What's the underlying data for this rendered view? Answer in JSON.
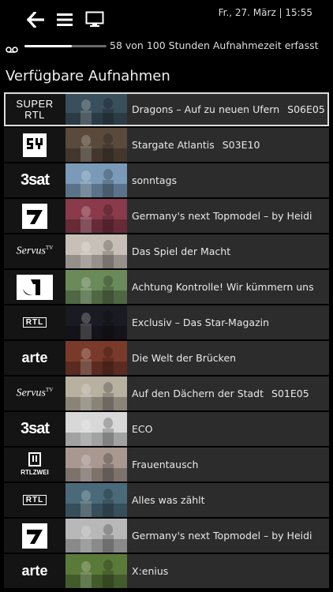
{
  "header": {
    "back_icon": "arrow-left-icon",
    "menu_icon": "hamburger-menu-icon",
    "tv_icon": "tv-monitor-icon",
    "datetime": "Fr., 27. März | 15:55"
  },
  "quota": {
    "icon": "voicemail-tape-icon",
    "used_fraction": 0.58,
    "label": "58 von 100 Stunden Aufnahmezeit erfasst"
  },
  "section_title": "Verfügbare Aufnahmen",
  "recordings": [
    {
      "channel": "SUPER RTL",
      "channel_line1": "SUPER",
      "channel_line2": "RTL",
      "logo": "superrtl",
      "title": "Dragons – Auf zu neuen Ufern",
      "episode": "S06E05",
      "selected": true,
      "thumb_color": "#3a4f5c"
    },
    {
      "channel": "SYFY",
      "logo": "syfy",
      "title": "Stargate Atlantis",
      "episode": "S03E10",
      "selected": false,
      "thumb_color": "#5a4a3c"
    },
    {
      "channel": "3sat",
      "logo": "3sat",
      "title": "sonntags",
      "episode": "",
      "selected": false,
      "thumb_color": "#7a9ab8"
    },
    {
      "channel": "ProSieben",
      "logo": "pro7",
      "title": "Germany's next Topmodel – by Heidi",
      "episode": "",
      "selected": false,
      "thumb_color": "#8a3a4a"
    },
    {
      "channel": "ServusTV",
      "channel_text": "Servus",
      "channel_sup": "TV",
      "logo": "servus",
      "title": "Das Spiel der Macht",
      "episode": "",
      "selected": false,
      "thumb_color": "#c8c0b8"
    },
    {
      "channel": "Kabel 1",
      "logo": "kabel1",
      "title": "Achtung Kontrolle! Wir kümmern uns",
      "episode": "",
      "selected": false,
      "thumb_color": "#6a8a5a"
    },
    {
      "channel": "RTL",
      "channel_text": "RTL",
      "logo": "rtl",
      "title": "Exclusiv – Das Star-Magazin",
      "episode": "",
      "selected": false,
      "thumb_color": "#1a1a22"
    },
    {
      "channel": "arte",
      "channel_text": "arte",
      "logo": "arte",
      "title": "Die Welt der Brücken",
      "episode": "",
      "selected": false,
      "thumb_color": "#7a3a2a"
    },
    {
      "channel": "ServusTV",
      "channel_text": "Servus",
      "channel_sup": "TV",
      "logo": "servus",
      "title": "Auf den Dächern der Stadt",
      "episode": "S01E05",
      "selected": false,
      "thumb_color": "#b8b0a0"
    },
    {
      "channel": "3sat",
      "logo": "3sat",
      "title": "ECO",
      "episode": "",
      "selected": false,
      "thumb_color": "#d8d8d8"
    },
    {
      "channel": "RTLZWEI",
      "channel_text": "RTLZWEI",
      "logo": "rtl2",
      "title": "Frauentausch",
      "episode": "",
      "selected": false,
      "thumb_color": "#a89890"
    },
    {
      "channel": "RTL",
      "channel_text": "RTL",
      "logo": "rtl",
      "title": "Alles was zählt",
      "episode": "",
      "selected": false,
      "thumb_color": "#4a6a7a"
    },
    {
      "channel": "ProSieben",
      "logo": "pro7",
      "title": "Germany's next Topmodel – by Heidi",
      "episode": "",
      "selected": false,
      "thumb_color": "#b8b8b8"
    },
    {
      "channel": "arte",
      "channel_text": "arte",
      "logo": "arte",
      "title": "X:enius",
      "episode": "",
      "selected": false,
      "thumb_color": "#5a7a3a"
    }
  ]
}
